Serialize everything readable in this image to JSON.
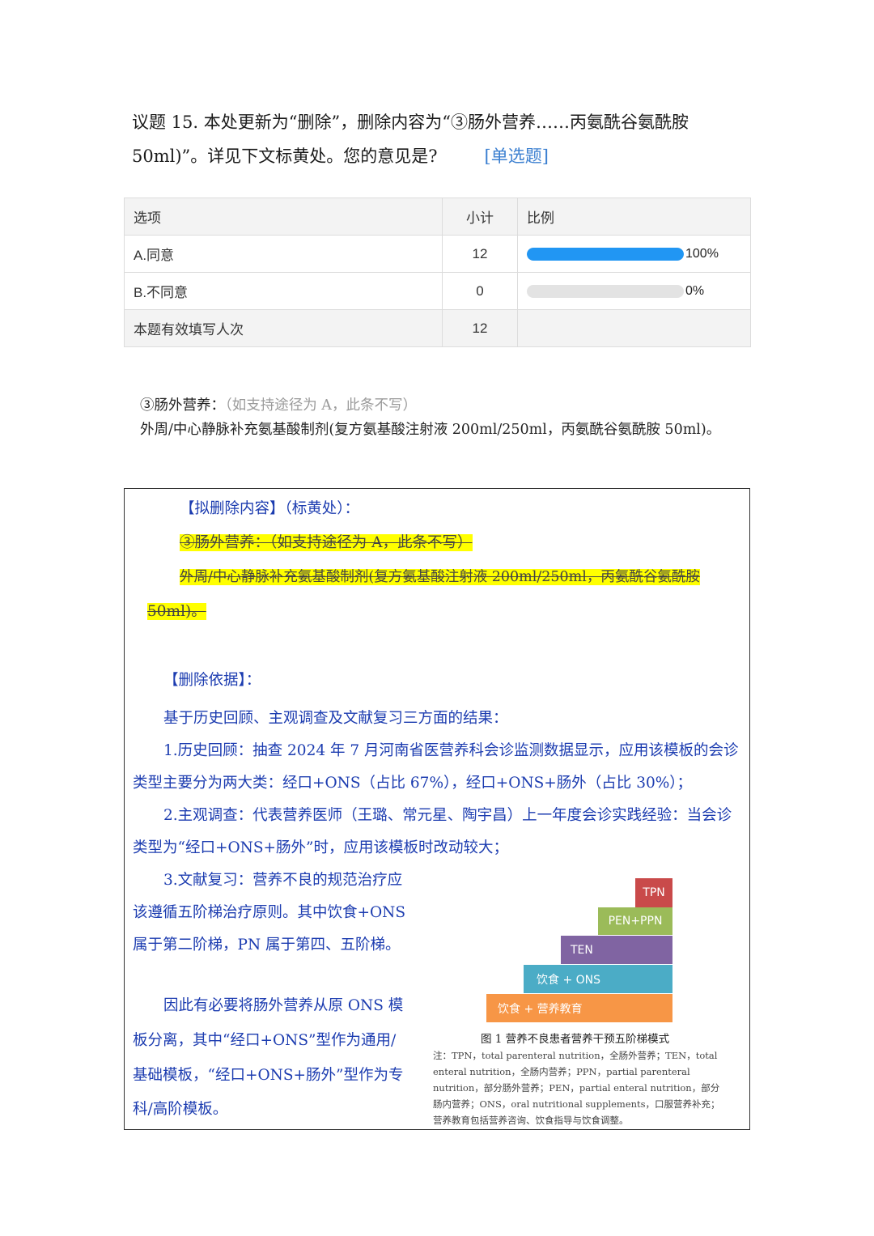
{
  "question": {
    "line1": "议题 15. 本处更新为“删除”，删除内容为“③肠外营养……丙氨酰谷氨酰胺",
    "line2": "50ml)”。详见下文标黄处。您的意见是?",
    "type_tag": "[单选题]"
  },
  "table": {
    "headers": [
      "选项",
      "小计",
      "比例"
    ],
    "rows": [
      {
        "option": "A.同意",
        "count": "12",
        "percent": "100%",
        "fraction": 1.0
      },
      {
        "option": "B.不同意",
        "count": "0",
        "percent": "0%",
        "fraction": 0.0
      }
    ],
    "total_label": "本题有效填写人次",
    "total_count": "12",
    "bar_color": "#2196f3"
  },
  "original": {
    "heading": "③肠外营养：",
    "heading_note": "（如支持途径为 A，此条不写）",
    "body": "外周/中心静脉补充氨基酸制剂(复方氨基酸注射液 200ml/250ml，丙氨酰谷氨酰胺 50ml)。"
  },
  "box": {
    "proposed_title": "【拟删除内容】（标黄处）：",
    "struck_line1": "③肠外营养：（如支持途径为 A，此条不写）",
    "struck_line2": "外周/中心静脉补充氨基酸制剂(复方氨基酸注射液 200ml/250ml，丙氨酰谷氨酰胺",
    "struck_line3": "50ml)。",
    "basis_title": "【删除依据】：",
    "basis_intro": "基于历史回顾、主观调查及文献复习三方面的结果：",
    "item1_a": "1.历史回顾：抽查 2024 年 7 月河南省医营养科会诊监测数据显示，应用该模板的会诊",
    "item1_b": "类型主要分为两大类：经口+ONS（占比 67%），经口+ONS+肠外（占比 30%）；",
    "item2_a": "2.主观调查：代表营养医师（王璐、常元星、陶宇昌）上一年度会诊实践经验：当会诊",
    "item2_b": "类型为“经口+ONS+肠外”时，应用该模板时改动较大；",
    "item3_a": "3.文献复习：营养不良的规范治疗应",
    "item3_b": "该遵循五阶梯治疗原则。其中饮食+ONS",
    "item3_c": "属于第二阶梯，PN 属于第四、五阶梯。",
    "concl_a": "因此有必要将肠外营养从原 ONS 模",
    "concl_b": "板分离，其中“经口+ONS”型作为通用/",
    "concl_c": "基础模板，“经口+ONS+肠外”型作为专",
    "concl_d": "科/高阶模板。"
  },
  "figure": {
    "steps": [
      {
        "label": "TPN",
        "color": "#c94a4a"
      },
      {
        "label": "PEN+PPN",
        "color": "#9bbb59"
      },
      {
        "label": "TEN",
        "color": "#8064a2"
      },
      {
        "label": "饮食 + ONS",
        "color": "#4bacc6"
      },
      {
        "label": "饮食 + 营养教育",
        "color": "#f79646"
      }
    ],
    "caption": "图 1  营养不良患者营养干预五阶梯模式",
    "note": "注：TPN，total parenteral nutrition，全肠外营养；TEN，total enteral nutrition，全肠内营养；PPN，partial parenteral nutrition，部分肠外营养；PEN，partial enteral nutrition，部分肠内营养；ONS，oral nutritional supplements，口服营养补充；营养教育包括营养咨询、饮食指导与饮食调整。"
  }
}
